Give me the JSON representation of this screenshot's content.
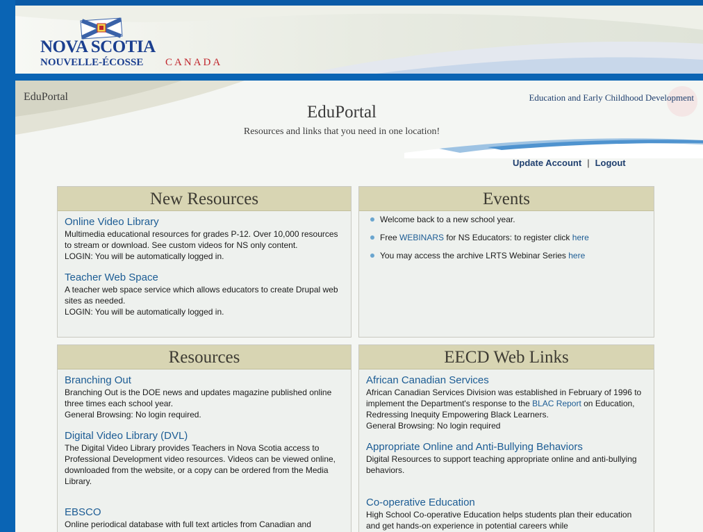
{
  "header": {
    "logo_line1": "NOVA SCOTIA",
    "logo_line2": "NOUVELLE-ÉCOSSE",
    "logo_line3": "CANADA",
    "site_label": "EduPortal",
    "site_title": "EduPortal",
    "tagline": "Resources and links that you need in one location!",
    "department": "Education and Early Childhood Development"
  },
  "account": {
    "update": "Update Account",
    "separator": "|",
    "logout": "Logout"
  },
  "new_resources": {
    "title": "New Resources",
    "items": [
      {
        "title": "Online Video Library",
        "text": "Multimedia educational resources for grades P-12.  Over 10,000 resources to stream or download.  See custom videos for NS only content.",
        "login": "LOGIN: You will be automatically logged in."
      },
      {
        "title": "Teacher Web Space",
        "text": "A teacher web space service which allows educators to create Drupal web sites as needed.",
        "login": "LOGIN: You will be automatically logged in."
      }
    ]
  },
  "events": {
    "title": "Events",
    "items": [
      {
        "text": "Welcome back to a new school year."
      },
      {
        "pre": "Free ",
        "link1": "WEBINARS",
        "mid": " for NS Educators: to register click ",
        "link2": "here"
      },
      {
        "pre": "You may access the archive LRTS Webinar Series ",
        "link": "here"
      }
    ]
  },
  "resources": {
    "title": "Resources",
    "items": [
      {
        "title": "Branching Out",
        "text": "Branching Out is the DOE news and updates magazine published online three times each school year.",
        "login": "General Browsing: No login required."
      },
      {
        "title": "Digital Video Library (DVL)",
        "text": "The Digital Video Library provides Teachers in Nova Scotia access to Professional Development video resources. Videos can be viewed online, downloaded from the website, or a copy can be ordered from the Media Library."
      },
      {
        "title": "EBSCO",
        "text": "Online periodical database with full text articles from Canadian and"
      }
    ]
  },
  "eecd_links": {
    "title": "EECD Web Links",
    "items": [
      {
        "title": "African Canadian Services",
        "text_pre": "African Canadian Services Division was established in February of 1996 to implement the Department's response to the ",
        "text_link": "BLAC Report",
        "text_post": " on Education, Redressing Inequity Empowering Black Learners.",
        "login": "General Browsing: No login required"
      },
      {
        "title": "Appropriate Online and Anti-Bullying Behaviors",
        "text": "Digital Resources to support teaching appropriate online and anti-bullying behaviors."
      },
      {
        "title": "Co-operative Education",
        "text": "High School Co-operative Education helps students plan their education and get hands-on experience in potential careers while"
      }
    ]
  },
  "colors": {
    "frame_blue": "#0a64b4",
    "panel_header": "#d8d5b3",
    "link": "#1c5c94",
    "flag_red": "#c0262d"
  }
}
